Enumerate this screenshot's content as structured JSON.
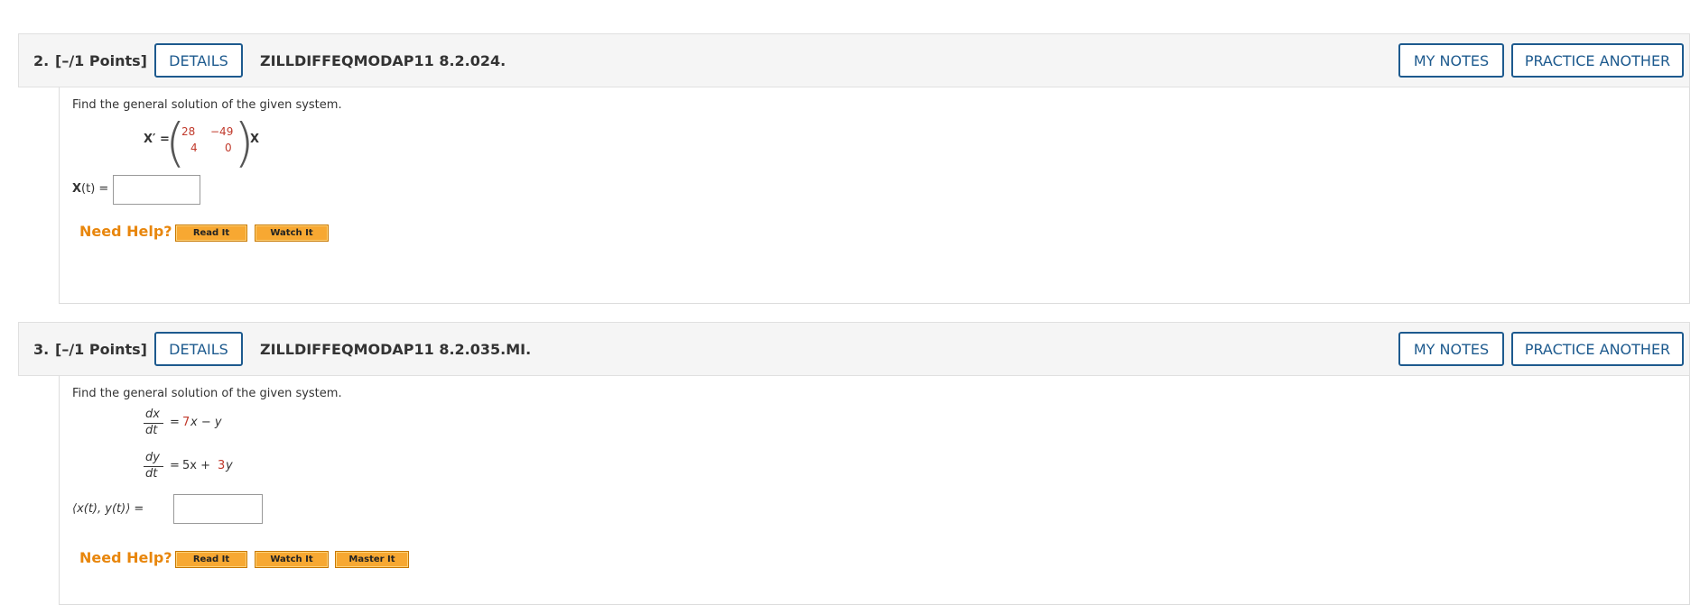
{
  "questions": [
    {
      "number": "2.",
      "points": "[–/1 Points]",
      "details_label": "DETAILS",
      "code": "ZILLDIFFEQMODAP11 8.2.024.",
      "my_notes_label": "MY NOTES",
      "practice_label": "PRACTICE ANOTHER",
      "prompt": "Find the general solution of the given system.",
      "equation": {
        "lhs": "X′ =",
        "matrix": [
          [
            "28",
            "−49"
          ],
          [
            "4",
            "0"
          ]
        ],
        "rhs": "X"
      },
      "answer_label_bold": "X",
      "answer_label_rest": "(t) =",
      "answer_value": "",
      "need_help": "Need Help?",
      "help_buttons": [
        "Read It",
        "Watch It"
      ]
    },
    {
      "number": "3.",
      "points": "[–/1 Points]",
      "details_label": "DETAILS",
      "code": "ZILLDIFFEQMODAP11 8.2.035.MI.",
      "my_notes_label": "MY NOTES",
      "practice_label": "PRACTICE ANOTHER",
      "prompt": "Find the general solution of the given system.",
      "equations": [
        {
          "num": "dx",
          "den": "dt",
          "eq": "=",
          "c1": "7",
          "t1": "x − y",
          "t2": "",
          "c2": ""
        },
        {
          "num": "dy",
          "den": "dt",
          "eq": "=",
          "c1": "",
          "t1": "5x + ",
          "c2": "3",
          "t2": "y"
        }
      ],
      "answer_label": "⟨x(t), y(t)⟩ =",
      "answer_value": "",
      "need_help": "Need Help?",
      "help_buttons": [
        "Read It",
        "Watch It",
        "Master It"
      ]
    }
  ],
  "colors": {
    "accent_blue": "#1d5a8e",
    "help_orange": "#e8860c",
    "help_button": "#f7a832",
    "coefficient_red": "#c0392b"
  }
}
